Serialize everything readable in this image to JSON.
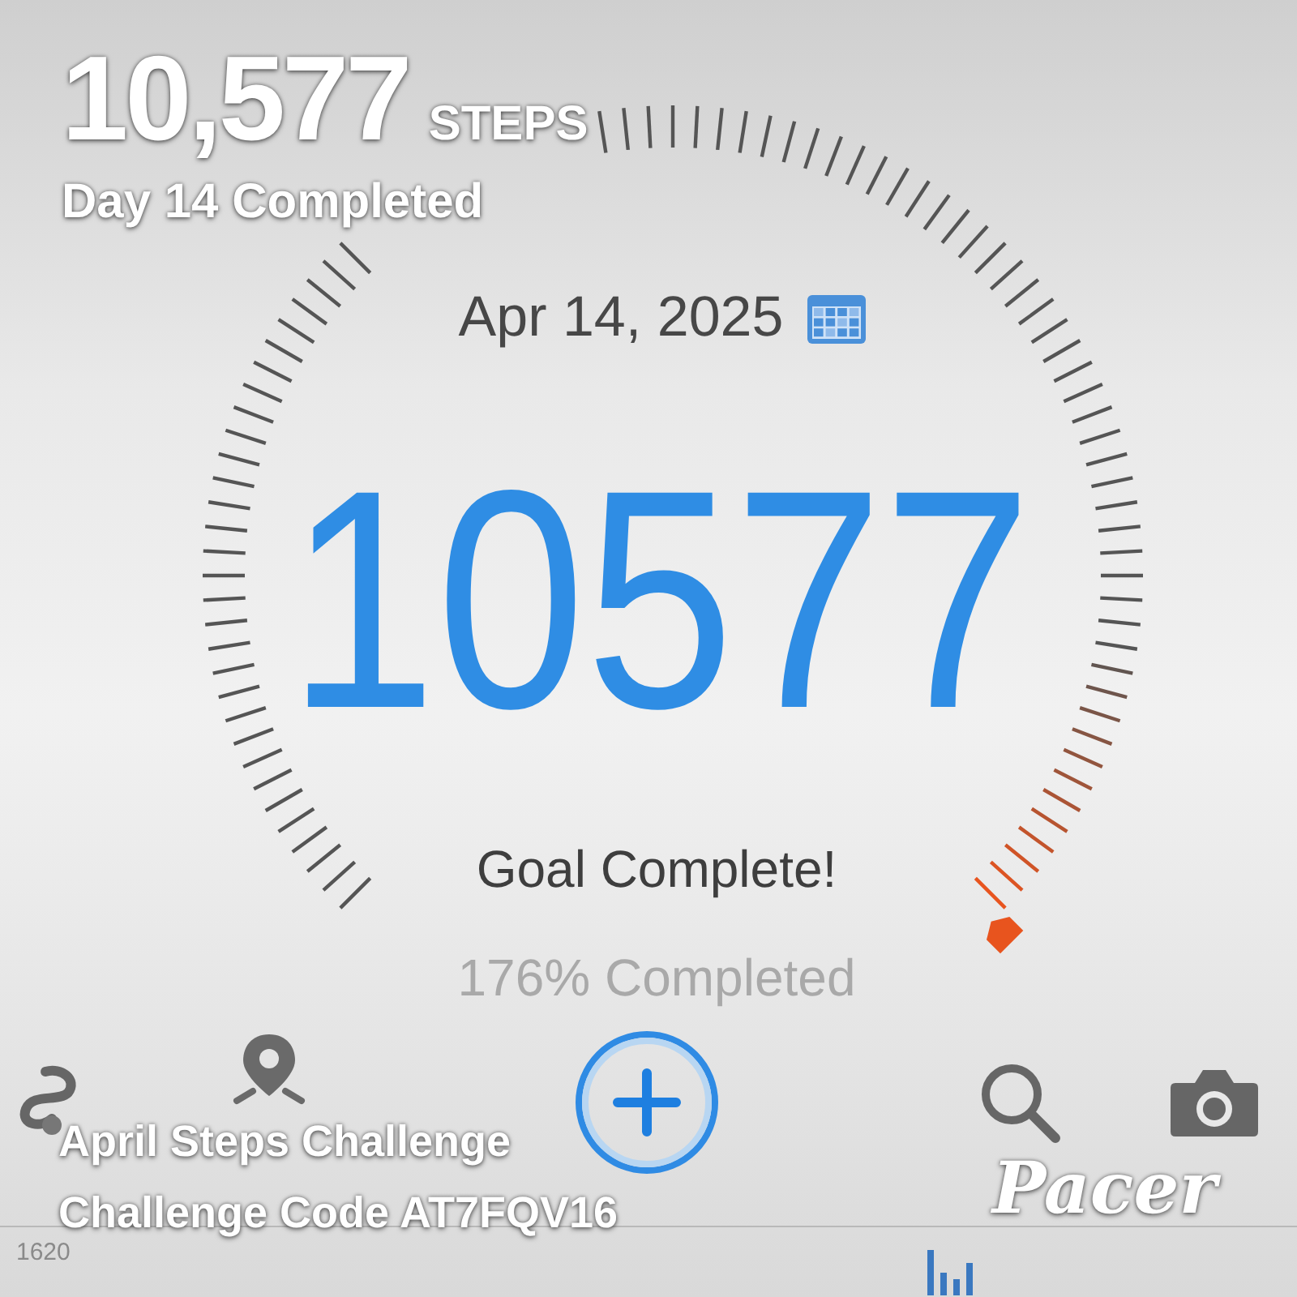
{
  "overlay": {
    "steps": "10,577",
    "unit": "STEPS",
    "day": "Day 14 Completed",
    "challenge": "April Steps Challenge",
    "code": "Challenge Code AT7FQV16",
    "logo": "Pacer"
  },
  "date": "Apr 14, 2025",
  "steps": "10577",
  "goal_status": "Goal Complete!",
  "progress": "176% Completed",
  "toolbar": [
    {
      "kind": "route"
    },
    {
      "kind": "pin"
    },
    {
      "kind": "add"
    },
    {
      "kind": "search"
    },
    {
      "kind": "camera"
    }
  ],
  "chart_strip": {
    "label": "1620"
  }
}
